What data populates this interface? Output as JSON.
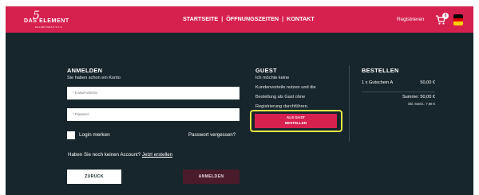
{
  "header": {
    "logo_text": "DAS ELEMENT",
    "logo_mark": "5",
    "logo_subtitle": "ERLEBNISBAD 5.0 E",
    "nav": [
      {
        "label": "STARTSEITE"
      },
      {
        "label": "ÖFFNUNGSZEITEN"
      },
      {
        "label": "KONTAKT"
      }
    ],
    "nav_separator": "|",
    "register_label": "Registrieren",
    "cart_count": "0",
    "cart_icon": "shopping-cart-icon",
    "flag_icon": "german-flag-icon",
    "colors": {
      "bar": "#d6214f",
      "background": "#17262d",
      "highlight": "#e8ec45"
    }
  },
  "login": {
    "title": "ANMELDEN",
    "subtitle": "Sie haben schon ein Konto",
    "email_placeholder": "* E-Mail Adresse",
    "password_placeholder": "* Passwort",
    "remember_label": "Login merken",
    "forgot_label": "Passwort vergessen?",
    "no_account_text": "Haben Sie noch keinen Account?",
    "register_link": "Jetzt erstellen",
    "back_button": "ZURÜCK",
    "login_button": "ANMELDEN"
  },
  "guest": {
    "title": "GUEST",
    "description_lines": [
      "Ich möchte keine",
      "Kundenvorteile nutzen und die",
      "Bestellung als Gast ohne",
      "Registrierung durchführen."
    ],
    "button_line1": "ALS GAST",
    "button_line2": "BESTELLEN"
  },
  "order": {
    "title": "BESTELLEN",
    "item_label": "1 x Gutschein A",
    "item_price": "50,00 €",
    "sum_label": "Summe: 50,00 €",
    "vat_label": "inkl. MwSt.: 7,98 €"
  }
}
